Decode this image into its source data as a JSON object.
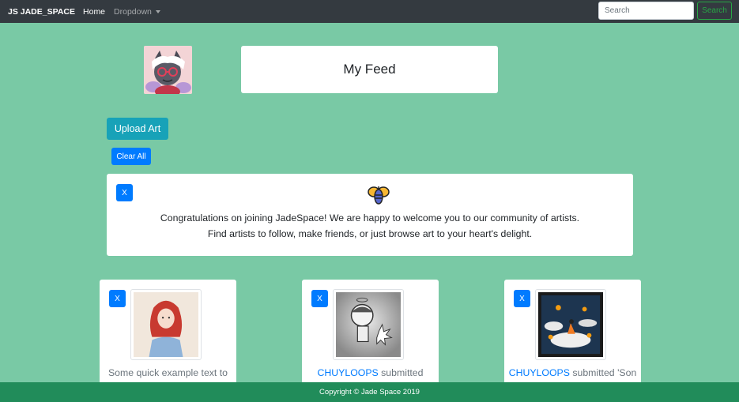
{
  "navbar": {
    "brand": "JS JADE_SPACE",
    "home_label": "Home",
    "dropdown_label": "Dropdown",
    "search_placeholder": "Search",
    "search_button": "Search"
  },
  "profile": {
    "feed_title": "My Feed"
  },
  "actions": {
    "upload_label": "Upload Art",
    "clear_label": "Clear All"
  },
  "welcome": {
    "dismiss_label": "X",
    "line1": "Congratulations on joining JadeSpace! We are happy to welcome you to our community of artists.",
    "line2": "Find artists to follow, make friends, or just browse art to your heart's delight."
  },
  "cards": [
    {
      "dismiss_label": "X",
      "user": "",
      "text": "Some quick example text to"
    },
    {
      "dismiss_label": "X",
      "user": "CHUYLOOPS",
      "text": " submitted"
    },
    {
      "dismiss_label": "X",
      "user": "CHUYLOOPS",
      "text": " submitted 'Son"
    }
  ],
  "footer": {
    "copyright": "Copyright © Jade Space 2019"
  },
  "colors": {
    "background": "#79c9a5",
    "navbar": "#343a40",
    "footer": "#218c5a",
    "primary": "#007bff",
    "info": "#17a2b8",
    "success": "#28a745"
  }
}
